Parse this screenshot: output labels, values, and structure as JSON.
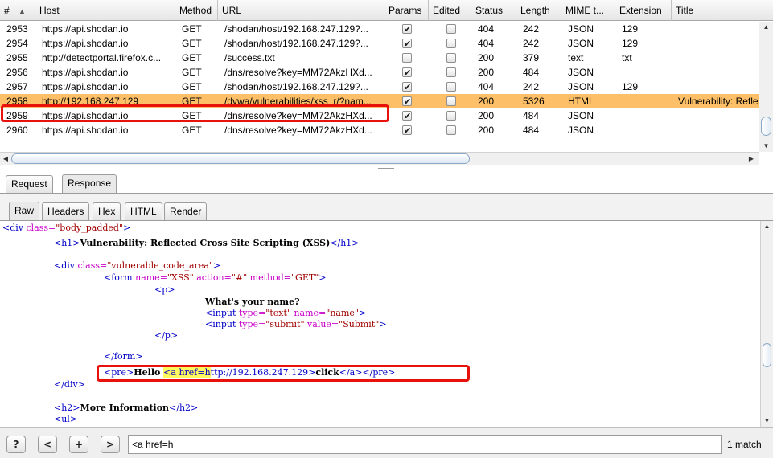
{
  "history": {
    "columns": [
      "#",
      "Host",
      "Method",
      "URL",
      "Params",
      "Edited",
      "Status",
      "Length",
      "MIME t...",
      "Extension",
      "Title"
    ],
    "rows": [
      {
        "id": "2953",
        "host": "https://api.shodan.io",
        "method": "GET",
        "url": "/shodan/host/192.168.247.129?...",
        "params": true,
        "edited": false,
        "status": "404",
        "length": "242",
        "mime": "JSON",
        "ext": "129",
        "title": ""
      },
      {
        "id": "2954",
        "host": "https://api.shodan.io",
        "method": "GET",
        "url": "/shodan/host/192.168.247.129?...",
        "params": true,
        "edited": false,
        "status": "404",
        "length": "242",
        "mime": "JSON",
        "ext": "129",
        "title": ""
      },
      {
        "id": "2955",
        "host": "http://detectportal.firefox.c...",
        "method": "GET",
        "url": "/success.txt",
        "params": false,
        "edited": false,
        "status": "200",
        "length": "379",
        "mime": "text",
        "ext": "txt",
        "title": ""
      },
      {
        "id": "2956",
        "host": "https://api.shodan.io",
        "method": "GET",
        "url": "/dns/resolve?key=MM72AkzHXd...",
        "params": true,
        "edited": false,
        "status": "200",
        "length": "484",
        "mime": "JSON",
        "ext": "",
        "title": ""
      },
      {
        "id": "2957",
        "host": "https://api.shodan.io",
        "method": "GET",
        "url": "/shodan/host/192.168.247.129?...",
        "params": true,
        "edited": false,
        "status": "404",
        "length": "242",
        "mime": "JSON",
        "ext": "129",
        "title": ""
      },
      {
        "id": "2958",
        "host": "http://192.168.247.129",
        "method": "GET",
        "url": "/dvwa/vulnerabilities/xss_r/?nam...",
        "params": true,
        "edited": false,
        "status": "200",
        "length": "5326",
        "mime": "HTML",
        "ext": "",
        "title": "Vulnerability: Refle"
      },
      {
        "id": "2959",
        "host": "https://api.shodan.io",
        "method": "GET",
        "url": "/dns/resolve?key=MM72AkzHXd...",
        "params": true,
        "edited": false,
        "status": "200",
        "length": "484",
        "mime": "JSON",
        "ext": "",
        "title": ""
      },
      {
        "id": "2960",
        "host": "https://api.shodan.io",
        "method": "GET",
        "url": "/dns/resolve?key=MM72AkzHXd...",
        "params": true,
        "edited": false,
        "status": "200",
        "length": "484",
        "mime": "JSON",
        "ext": "",
        "title": ""
      }
    ],
    "selected_row": 5
  },
  "tabs": {
    "request": "Request",
    "response": "Response"
  },
  "subtabs": {
    "raw": "Raw",
    "headers": "Headers",
    "hex": "Hex",
    "html": "HTML",
    "render": "Render"
  },
  "code": {
    "l1": {
      "open": "<div ",
      "attr": "class=",
      "val": "\"body_padded\"",
      "close": ">"
    },
    "l2": {
      "open": "<h1>",
      "text": "Vulnerability: Reflected Cross Site Scripting (XSS)",
      "close": "</h1>"
    },
    "l3": {
      "open": "<div ",
      "attr": "class=",
      "val": "\"vulnerable_code_area\"",
      "close": ">"
    },
    "l4": {
      "open": "<form ",
      "a1": "name=",
      "v1": "\"XSS\"",
      "a2": " action=",
      "v2": "\"#\"",
      "a3": " method=",
      "v3": "\"GET\"",
      "close": ">"
    },
    "l5": "<p>",
    "l6": "What's your name?",
    "l7": {
      "open": "<input ",
      "a1": "type=",
      "v1": "\"text\"",
      "a2": " name=",
      "v2": "\"name\"",
      "close": ">"
    },
    "l8": {
      "open": "<input ",
      "a1": "type=",
      "v1": "\"submit\"",
      "a2": " value=",
      "v2": "\"Submit\"",
      "close": ">"
    },
    "l9": "</p>",
    "l10": "</form>",
    "l11": {
      "pre": "<pre>",
      "hello": "Hello ",
      "match": "<a href=h",
      "rest": "ttp://192.168.247.129>",
      "click": "click",
      "end": "</a></pre>"
    },
    "l12": "</div>",
    "l13": {
      "open": "<h2>",
      "text": "More Information",
      "close": "</h2>"
    },
    "l14": "<ul>"
  },
  "search": {
    "help_label": "?",
    "prev_label": "<",
    "next_label": "+",
    "go_label": ">",
    "value": "<a href=h",
    "match_count": "1 match"
  },
  "colors": {
    "selected_row": "#fdc068",
    "highlight_box": "#e8120c",
    "match_highlight": "#fff85c",
    "tag": "#0000c8",
    "attr": "#c800c8",
    "string": "#a00000"
  }
}
